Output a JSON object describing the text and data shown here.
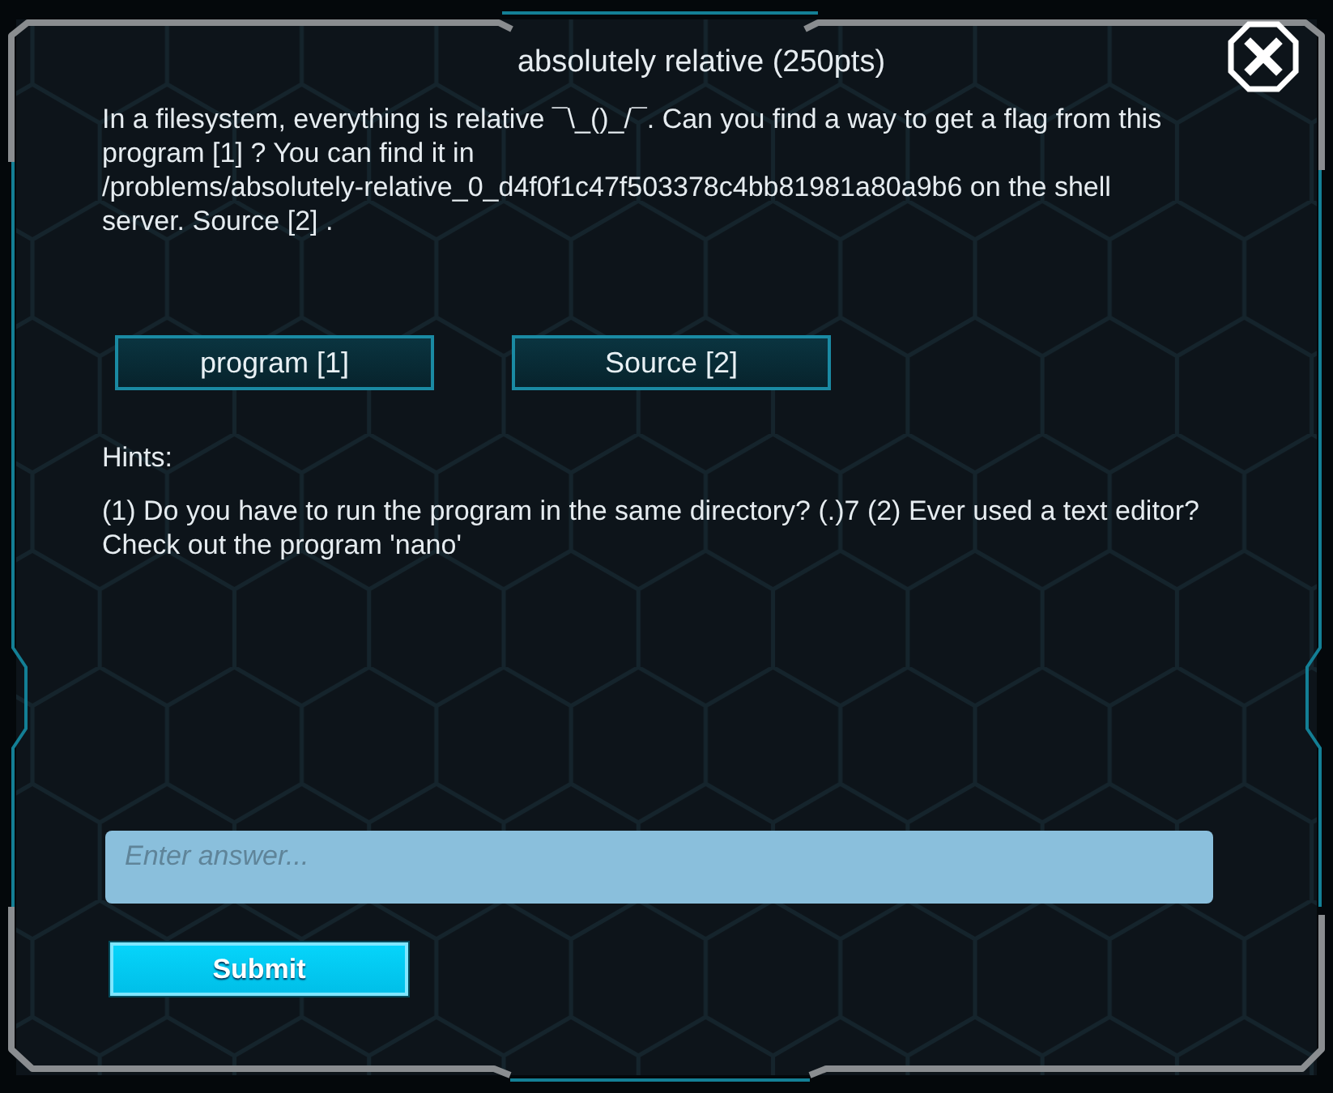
{
  "dialog": {
    "title": "absolutely relative (250pts)",
    "description": "In a filesystem, everything is relative ¯\\_()_/¯. Can you find a way to get a flag from this program [1] ? You can find it in /problems/absolutely-relative_0_d4f0f1c47f503378c4bb81981a80a9b6 on the shell server. Source [2] ."
  },
  "links": [
    {
      "label": "program [1]"
    },
    {
      "label": "Source [2]"
    }
  ],
  "hints": {
    "heading": "Hints:",
    "text": "(1) Do you have to run the program in the same directory? (.)7 (2) Ever used a text editor? Check out the program 'nano'"
  },
  "answer": {
    "placeholder": "Enter answer..."
  },
  "submit": {
    "label": "Submit"
  }
}
